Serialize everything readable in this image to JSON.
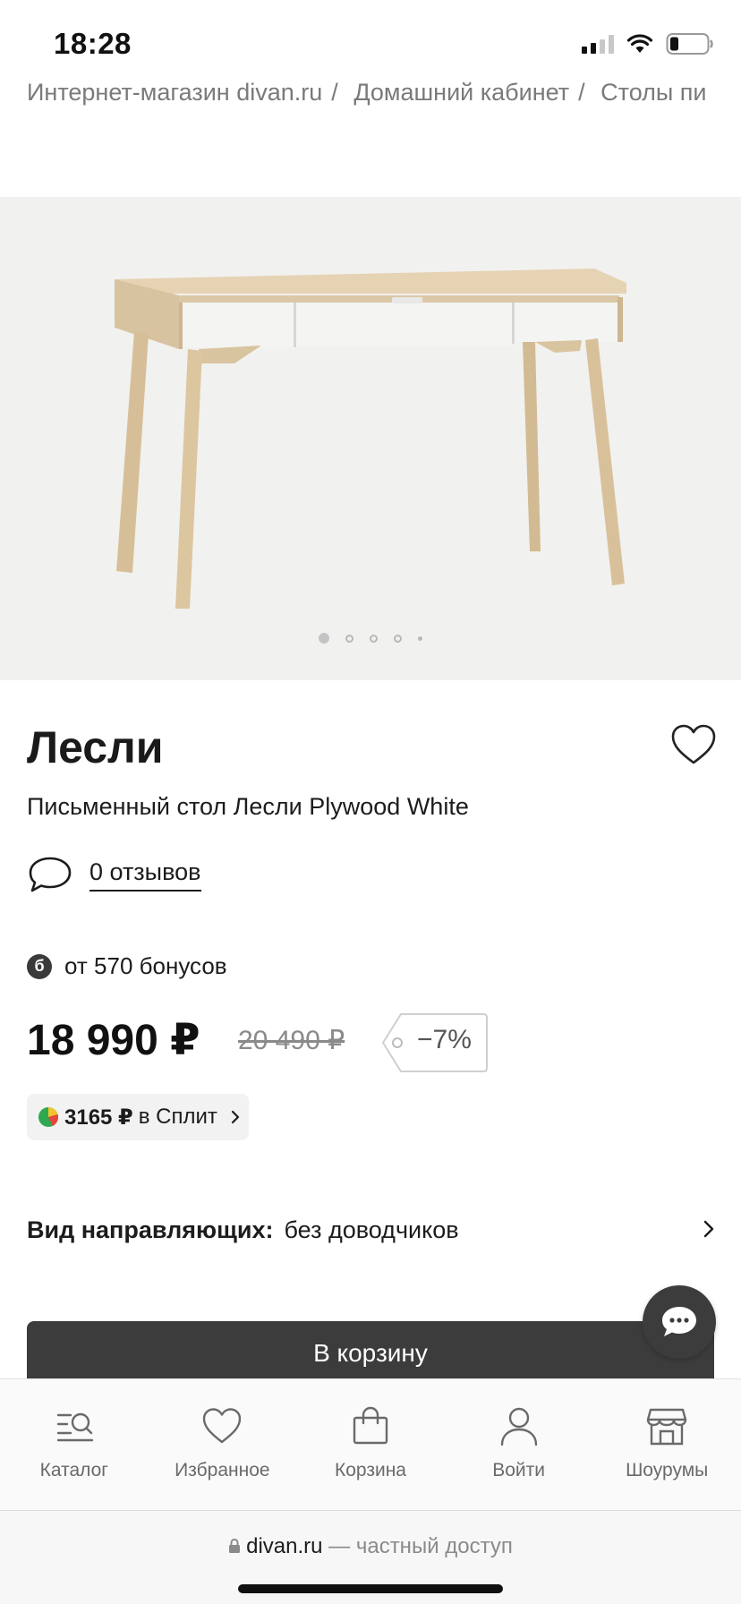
{
  "status_bar": {
    "time": "18:28"
  },
  "breadcrumb": [
    "Интернет-магазин divan.ru",
    "Домашний кабинет",
    "Столы пи"
  ],
  "breadcrumb_sep": "/",
  "gallery": {
    "slide_count": 5,
    "active_slide": 1
  },
  "product": {
    "title": "Лесли",
    "subtitle": "Письменный стол Лесли Plywood White",
    "reviews": "0 отзывов",
    "bonus_badge": "б",
    "bonus": "от 570 бонусов",
    "price": "18 990 ₽",
    "old_price": "20 490 ₽",
    "discount": "−7%",
    "split_amount": "3165 ₽",
    "split_text": "в Сплит"
  },
  "option": {
    "label": "Вид направляющих:",
    "value": "без доводчиков"
  },
  "cart_button": "В корзину",
  "bottom_nav": [
    {
      "label": "Каталог",
      "icon": "catalog-icon"
    },
    {
      "label": "Избранное",
      "icon": "heart-icon"
    },
    {
      "label": "Корзина",
      "icon": "bag-icon"
    },
    {
      "label": "Войти",
      "icon": "user-icon"
    },
    {
      "label": "Шоурумы",
      "icon": "store-icon"
    }
  ],
  "url_bar": {
    "domain": "divan.ru",
    "note": "— частный доступ"
  },
  "colors": {
    "accent_dark": "#3c3c3c",
    "gallery_bg": "#f1f1ef",
    "muted": "#7a7a7a"
  }
}
